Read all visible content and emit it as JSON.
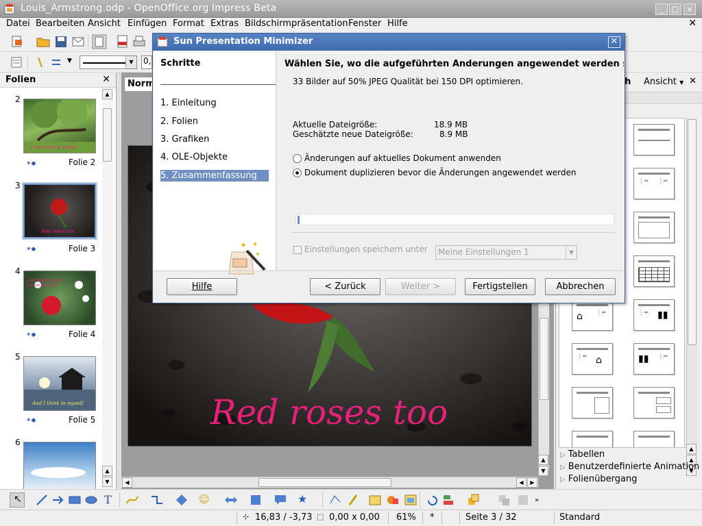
{
  "window": {
    "title": "Louis_Armstrong.odp - OpenOffice.org Impress Beta"
  },
  "menu": [
    "Datei",
    "Bearbeiten",
    "Ansicht",
    "Einfügen",
    "Format",
    "Extras",
    "Bildschirmpräsentation",
    "Fenster",
    "Hilfe"
  ],
  "slides_pane": {
    "title": "Folien",
    "slides": [
      {
        "num": "2",
        "label": "Folie 2",
        "caption": "I see trees of green"
      },
      {
        "num": "3",
        "label": "Folie 3",
        "caption": "Red roses too"
      },
      {
        "num": "4",
        "label": "Folie 4",
        "caption": "I see them bloom for me and you"
      },
      {
        "num": "5",
        "label": "Folie 5",
        "caption": "And I think to myself"
      },
      {
        "num": "6",
        "label": "",
        "caption": ""
      }
    ]
  },
  "main": {
    "view_tab": "Norm",
    "slide_text": "Red roses too"
  },
  "task_pane": {
    "header_partial": "ich",
    "view_menu": "Ansicht",
    "sections": [
      "Tabellen",
      "Benutzerdefinierte Animation",
      "Folienübergang"
    ]
  },
  "statusbar": {
    "position": "16,83 / -3,73",
    "size": "0,00 x 0,00",
    "zoom": "61%",
    "modified": "*",
    "page": "Seite 3 / 32",
    "layout": "Standard"
  },
  "dialog": {
    "title": "Sun Presentation Minimizer",
    "steps_title": "Schritte",
    "steps": [
      "1. Einleitung",
      "2. Folien",
      "3. Grafiken",
      "4. OLE-Objekte",
      "5. Zusammenfassung"
    ],
    "active_step": 4,
    "heading": "Wählen Sie, wo die aufgeführten Änderungen angewendet werden sollen",
    "summary": "33 Bilder auf 50% JPEG Qualität bei 150 DPI optimieren.",
    "current_size_label": "Aktuelle Dateigröße:",
    "current_size_value": "18.9 MB",
    "estimated_size_label": "Geschätzte neue Dateigröße:",
    "estimated_size_value": "8.9 MB",
    "option_apply_current": "Änderungen auf aktuelles Dokument anwenden",
    "option_duplicate": "Dokument duplizieren bevor die Änderungen angewendet werden",
    "selected_option": "duplicate",
    "save_settings_label": "Einstellungen speichern unter",
    "save_settings_name": "Meine Einstellungen 1",
    "buttons": {
      "help": "Hilfe",
      "back": "< Zurück",
      "next": "Weiter >",
      "finish": "Fertigstellen",
      "cancel": "Abbrechen"
    }
  },
  "colors": {
    "dialog_title": "#4a75b8",
    "selection": "#6f8fc2",
    "slide_text": "#e8207a"
  }
}
